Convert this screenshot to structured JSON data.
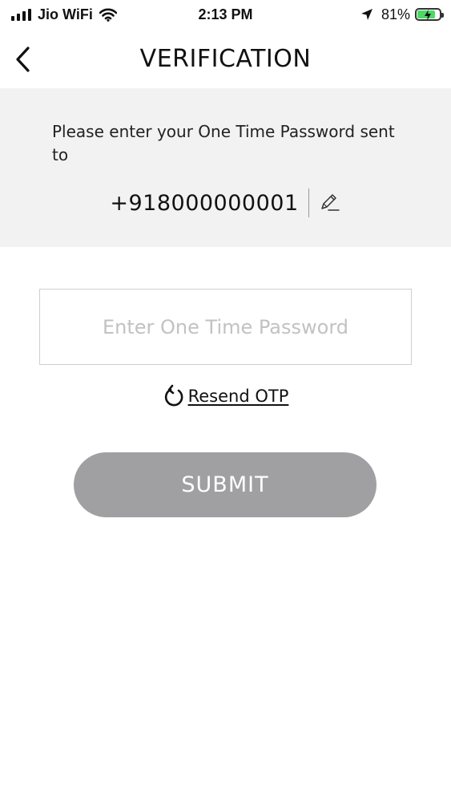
{
  "status_bar": {
    "carrier": "Jio WiFi",
    "time": "2:13 PM",
    "battery_percent": "81%",
    "battery_level": 0.81,
    "battery_color": "#4cd964",
    "icons": [
      "signal-icon",
      "wifi-icon",
      "location-arrow-icon",
      "battery-charging-icon"
    ]
  },
  "header": {
    "title": "VERIFICATION",
    "back_icon": "chevron-left-icon"
  },
  "info": {
    "message": "Please enter your One Time Password sent to",
    "phone_number": "+918000000001",
    "edit_icon": "pencil-icon"
  },
  "form": {
    "otp_placeholder": "Enter One Time Password",
    "otp_value": "",
    "resend_label": "Resend OTP",
    "resend_icon": "refresh-icon",
    "submit_label": "SUBMIT",
    "submit_color": "#a0a0a3"
  }
}
